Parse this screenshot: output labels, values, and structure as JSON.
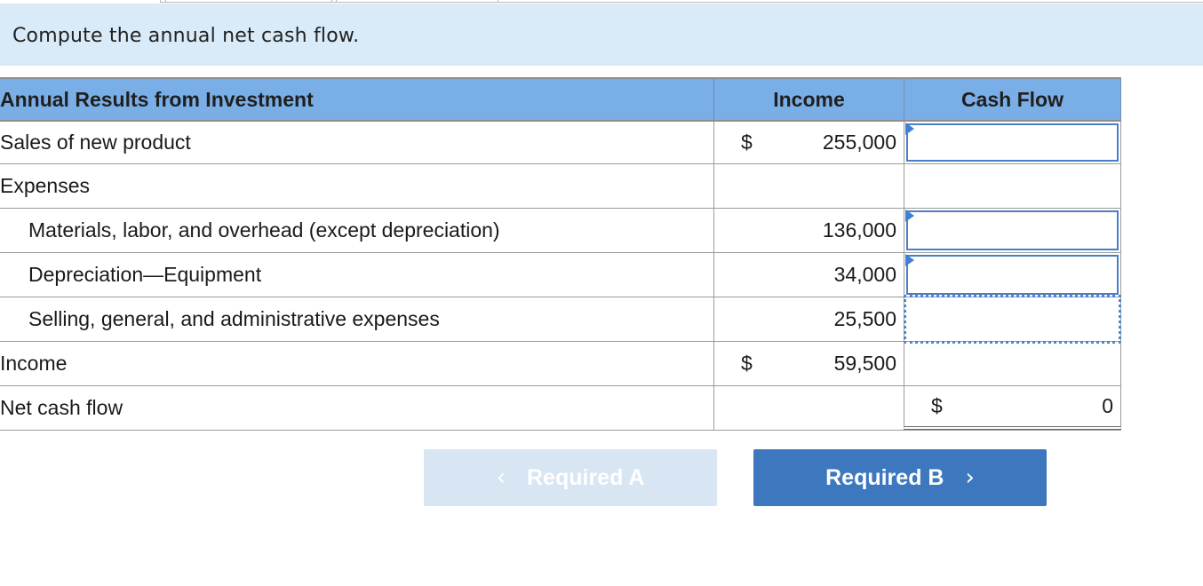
{
  "instruction": "Compute the annual net cash flow.",
  "table": {
    "headers": {
      "col1": "Annual Results from Investment",
      "col2": "Income",
      "col3": "Cash Flow"
    },
    "rows": [
      {
        "label": "Sales of new product",
        "dollar": "$",
        "income": "255,000",
        "cash_flow": ""
      },
      {
        "label": "Expenses",
        "dollar": "",
        "income": "",
        "cash_flow": ""
      },
      {
        "label": "Materials, labor, and overhead (except depreciation)",
        "dollar": "",
        "income": "136,000",
        "cash_flow": ""
      },
      {
        "label": "Depreciation—Equipment",
        "dollar": "",
        "income": "34,000",
        "cash_flow": ""
      },
      {
        "label": "Selling, general, and administrative expenses",
        "dollar": "",
        "income": "25,500",
        "cash_flow": ""
      },
      {
        "label": "Income",
        "dollar": "$",
        "income": "59,500",
        "cash_flow": ""
      },
      {
        "label": "Net cash flow",
        "dollar": "",
        "income": "",
        "cash_flow_dollar": "$",
        "cash_flow": "0"
      }
    ]
  },
  "buttons": {
    "prev_label": "Required A",
    "prev_icon": "chevron-left-icon",
    "prev_glyph": "‹",
    "next_label": "Required B",
    "next_icon": "chevron-right-icon",
    "next_glyph": "›"
  },
  "colors": {
    "instruction_bg": "#d9ebf8",
    "header_bg": "#7aaee6",
    "input_border": "#4a7fc6",
    "next_button": "#3d78bf",
    "prev_button_disabled": "#d8e5f3"
  }
}
